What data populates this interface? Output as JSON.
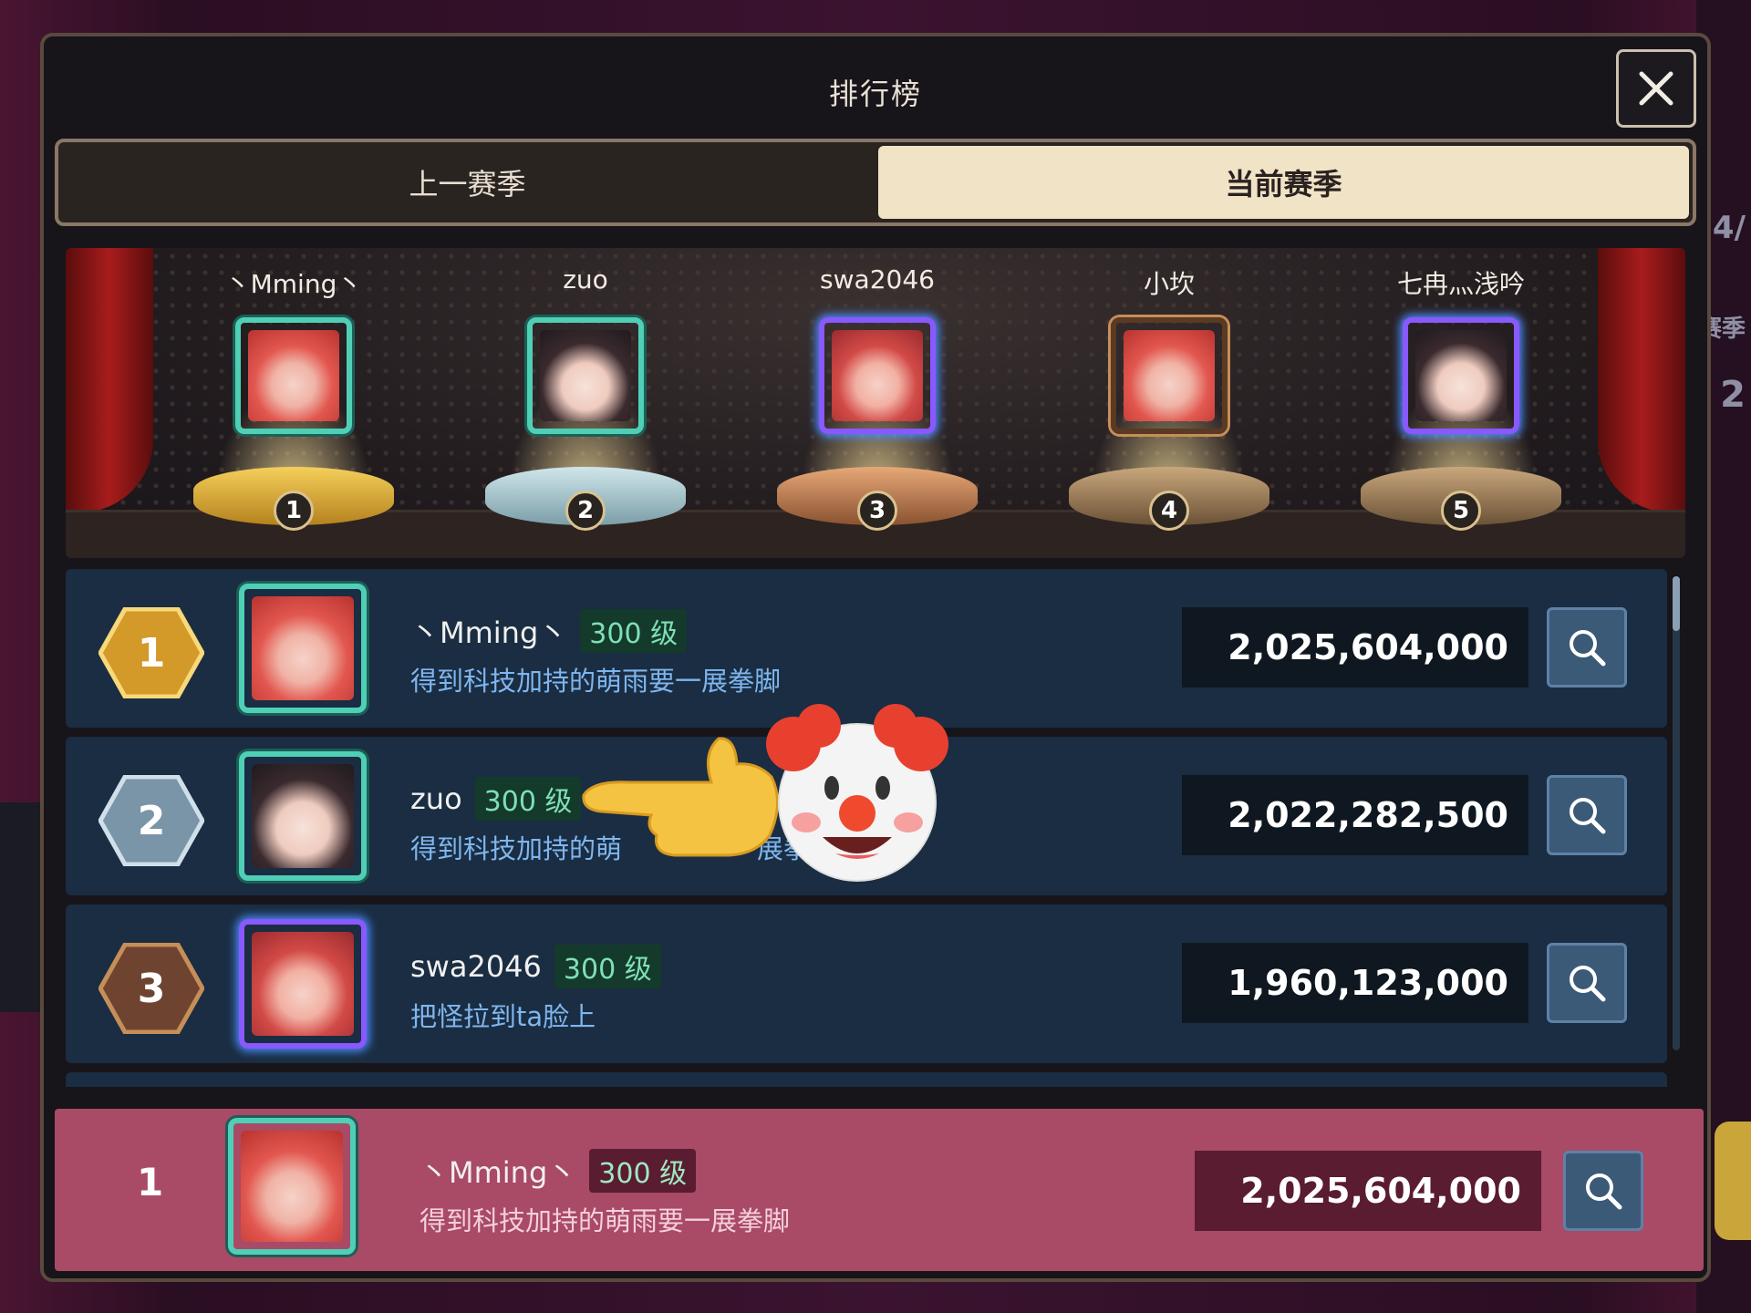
{
  "window": {
    "title": "排行榜"
  },
  "tabs": [
    {
      "label": "上一赛季",
      "active": false
    },
    {
      "label": "当前赛季",
      "active": true
    }
  ],
  "podium": [
    {
      "name": "丶Mming丶",
      "rank": "1",
      "avatar": "red-hair-girl",
      "frame": "teal"
    },
    {
      "name": "zuo",
      "rank": "2",
      "avatar": "dark-hair-girl",
      "frame": "teal"
    },
    {
      "name": "swa2046",
      "rank": "3",
      "avatar": "red-hair-girl",
      "frame": "purple"
    },
    {
      "name": "小坎",
      "rank": "4",
      "avatar": "red-hair-girl",
      "frame": "brown"
    },
    {
      "name": "七冉灬浅吟",
      "rank": "5",
      "avatar": "dark-hair-girl",
      "frame": "purple"
    }
  ],
  "rows": [
    {
      "rank": "1",
      "name": "丶Mming丶",
      "level": "300 级",
      "guild": "得到科技加持的萌雨要一展拳脚",
      "score": "2,025,604,000",
      "medal_color": "#d39a2a"
    },
    {
      "rank": "2",
      "name": "zuo",
      "level": "300 级",
      "guild": "得到科技加持的萌",
      "guild_tail": "展拳",
      "score": "2,022,282,500",
      "medal_color": "#8aa7b9"
    },
    {
      "rank": "3",
      "name": "swa2046",
      "level": "300 级",
      "guild": "把怪拉到ta脸上",
      "score": "1,960,123,000",
      "medal_color": "#8a5a3a"
    }
  ],
  "self": {
    "rank": "1",
    "name": "丶Mming丶",
    "level": "300 级",
    "guild": "得到科技加持的萌雨要一展拳脚",
    "score": "2,025,604,000"
  },
  "overlay": {
    "emojis": [
      "pointing-hand",
      "clown-face"
    ]
  },
  "background": {
    "right_fragments": [
      "4/",
      "赛季",
      "2"
    ]
  }
}
